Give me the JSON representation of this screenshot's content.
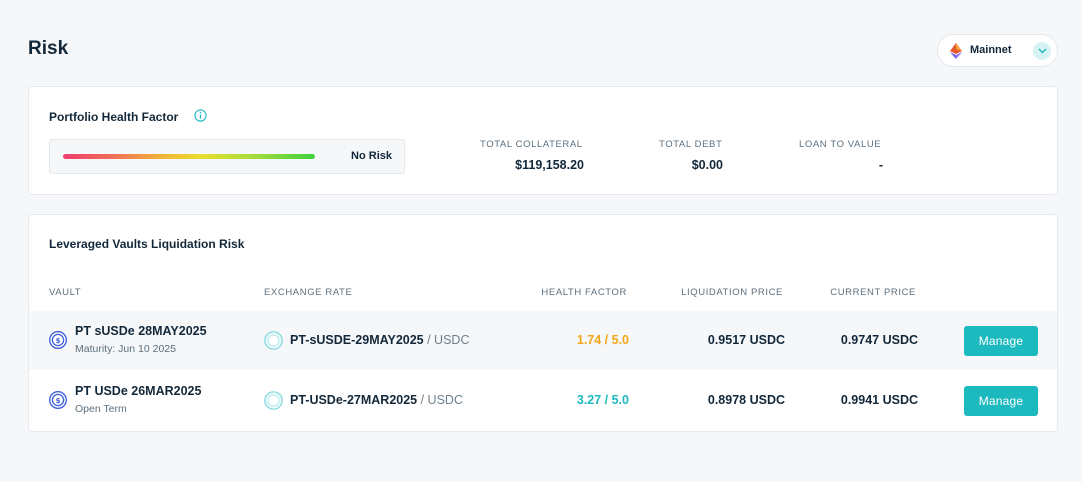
{
  "page": {
    "title": "Risk"
  },
  "network": {
    "label": "Mainnet",
    "icon": "ethereum-icon"
  },
  "health": {
    "title": "Portfolio Health Factor",
    "risk_label": "No Risk",
    "stats": [
      {
        "label": "TOTAL COLLATERAL",
        "value": "$119,158.20"
      },
      {
        "label": "TOTAL DEBT",
        "value": "$0.00"
      },
      {
        "label": "LOAN TO VALUE",
        "value": "-"
      }
    ]
  },
  "vaults": {
    "title": "Leveraged Vaults Liquidation Risk",
    "columns": [
      "VAULT",
      "EXCHANGE RATE",
      "HEALTH FACTOR",
      "LIQUIDATION PRICE",
      "CURRENT PRICE"
    ],
    "rows": [
      {
        "name": "PT sUSDe 28MAY2025",
        "sub": "Maturity: Jun 10 2025",
        "rate_token": "PT-sUSDE-29MAY2025",
        "rate_quote": " / USDC",
        "health": "1.74 / 5.0",
        "health_color": "#f2a516",
        "liquidation": "0.9517 USDC",
        "current": "0.9747 USDC",
        "button": "Manage"
      },
      {
        "name": "PT USDe 26MAR2025",
        "sub": "Open Term",
        "rate_token": "PT-USDe-27MAR2025",
        "rate_quote": " / USDC",
        "health": "3.27 / 5.0",
        "health_color": "#1cb9bf",
        "liquidation": "0.8978 USDC",
        "current": "0.9941 USDC",
        "button": "Manage"
      }
    ]
  },
  "colors": {
    "accent": "#1cb9bf",
    "text": "#12283a",
    "muted": "#5c6f7d",
    "background": "#f5f7f9"
  }
}
